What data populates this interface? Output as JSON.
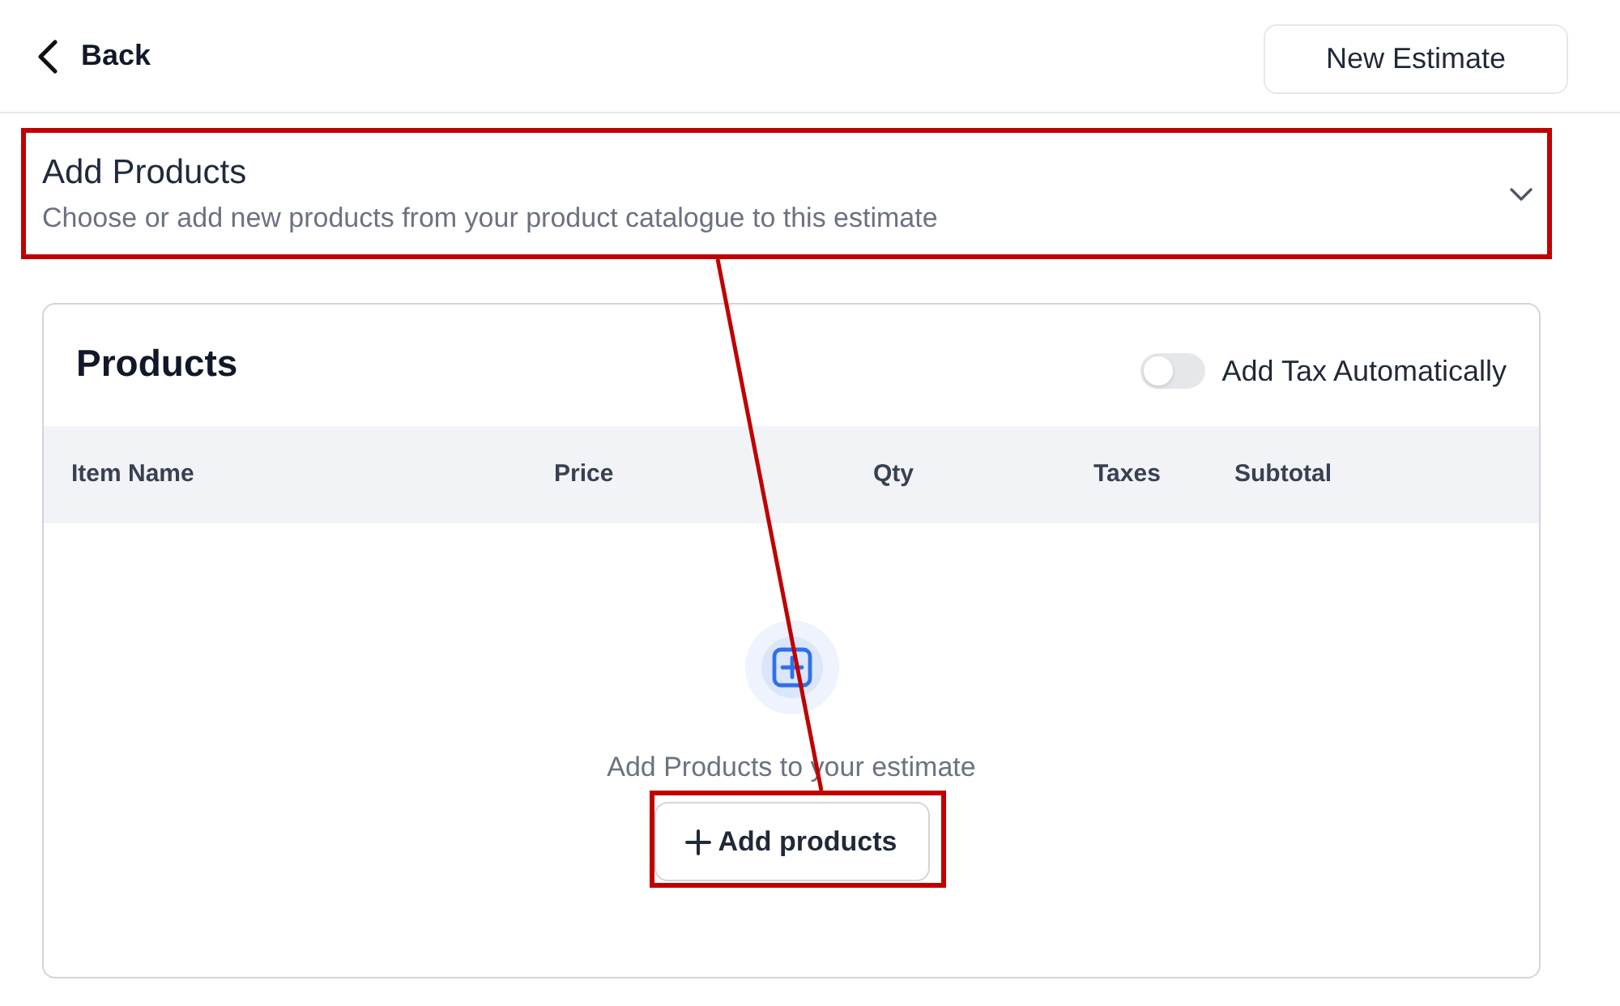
{
  "top_bar": {
    "back": {
      "label": "Back"
    },
    "new_estimate_button": {
      "label": "New Estimate"
    }
  },
  "section": {
    "title": "Add Products",
    "subtitle": "Choose or add new products from your product catalogue to this estimate"
  },
  "products_card": {
    "title": "Products",
    "tax_toggle": {
      "label": "Add Tax Automatically",
      "on": false
    },
    "table": {
      "columns": [
        "Item Name",
        "Price",
        "Qty",
        "Taxes",
        "Subtotal"
      ]
    },
    "empty_state": {
      "message": "Add Products to your estimate",
      "button": {
        "label": "Add products"
      }
    }
  }
}
